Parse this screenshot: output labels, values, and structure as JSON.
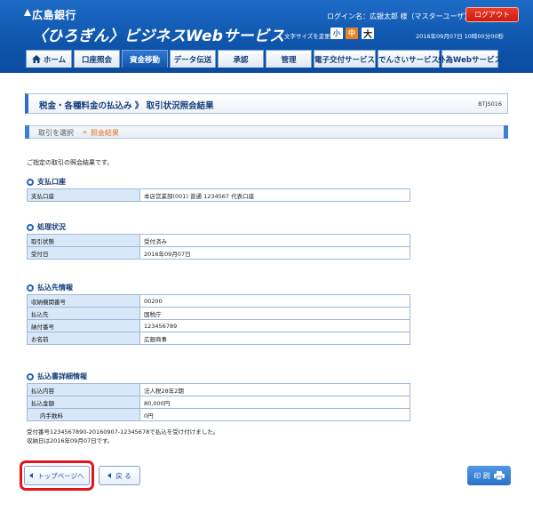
{
  "header": {
    "logo_small": "広島銀行",
    "logo_big": "〈ひろぎん〉ビジネスWebサービス",
    "login_line": "ログイン名：広銀太郎 様（マスターユーザ）",
    "logout_label": "ログアウト",
    "fontsize_label": "文字サイズを変更",
    "fontsize_small": "小",
    "fontsize_medium": "中",
    "fontsize_large": "大",
    "date_line": "2016年09月07日 10時00分00秒"
  },
  "nav": {
    "tabs": [
      {
        "label": "ホーム"
      },
      {
        "label": "口座照会"
      },
      {
        "label": "資金移動"
      },
      {
        "label": "データ伝送"
      },
      {
        "label": "承認"
      },
      {
        "label": "管理"
      },
      {
        "label": "電子交付サービス"
      },
      {
        "label": "でんさいサービス"
      },
      {
        "label": "外為Webサービス"
      }
    ],
    "active_index": 2
  },
  "page": {
    "title": "税金・各種料金の払込み 》 取引状況照会結果",
    "code": "BTJS016",
    "steps": [
      "取引を選択",
      "照会結果"
    ],
    "step_separator": "»",
    "intro": "ご指定の取引の照会結果です。"
  },
  "sections": {
    "account": {
      "title": "支払口座",
      "rows": [
        {
          "label": "支払口座",
          "value": "本店営業部(001) 普通 1234567 代表口座"
        }
      ]
    },
    "status": {
      "title": "処理状況",
      "rows": [
        {
          "label": "取引状態",
          "value": "受付済み"
        },
        {
          "label": "受付日",
          "value": "2016年09月07日"
        }
      ]
    },
    "payee": {
      "title": "払込先情報",
      "rows": [
        {
          "label": "収納機関番号",
          "value": "00200"
        },
        {
          "label": "払込先",
          "value": "国税庁"
        },
        {
          "label": "納付番号",
          "value": "123456789"
        },
        {
          "label": "お名前",
          "value": "広銀商事"
        }
      ]
    },
    "detail": {
      "title": "払込書詳細情報",
      "rows": [
        {
          "label": "払込内容",
          "value": "法人税28年2期"
        },
        {
          "label": "払込金額",
          "value": "80,000円"
        },
        {
          "label": "内手数料",
          "value": "0円"
        }
      ]
    }
  },
  "notes": [
    "受付番号1234567890-20160907-12345678で払込を受け付けました。",
    "収納日は2016年09月07日です。"
  ],
  "buttons": {
    "top_page": "トップページへ",
    "back": "戻 る",
    "print": "印 刷"
  },
  "colors": {
    "header_blue": "#0f56ad",
    "highlight_red": "#e3141b",
    "accent_orange": "#e3701c",
    "label_cell": "#d8e8f8"
  }
}
